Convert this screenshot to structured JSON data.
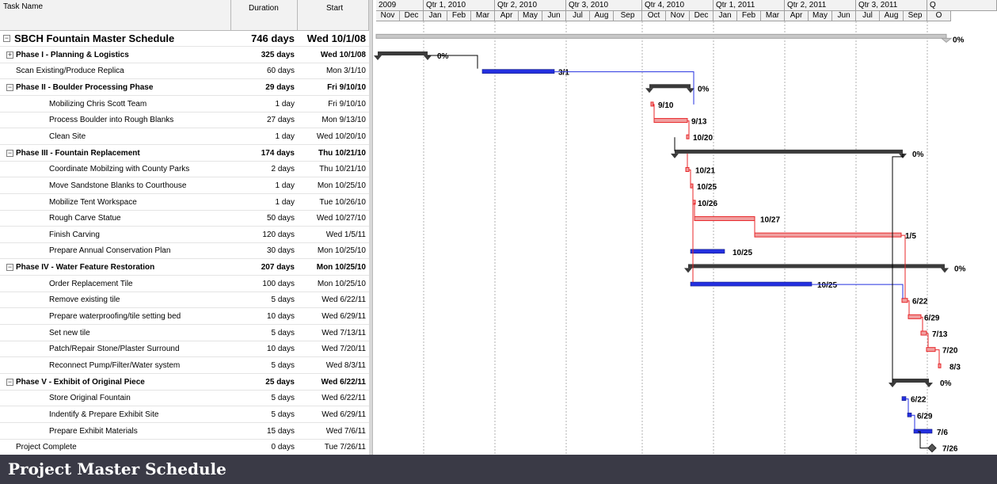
{
  "columns": {
    "name": "Task Name",
    "duration": "Duration",
    "start": "Start"
  },
  "timeline_top": [
    "2009",
    "Qtr 1, 2010",
    "Qtr 2, 2010",
    "Qtr 3, 2010",
    "Qtr 4, 2010",
    "Qtr 1, 2011",
    "Qtr 2, 2011",
    "Qtr 3, 2011",
    "Q"
  ],
  "timeline_months": [
    "Nov",
    "Dec",
    "Jan",
    "Feb",
    "Mar",
    "Apr",
    "May",
    "Jun",
    "Jul",
    "Aug",
    "Sep",
    "Oct",
    "Nov",
    "Dec",
    "Jan",
    "Feb",
    "Mar",
    "Apr",
    "May",
    "Jun",
    "Jul",
    "Aug",
    "Sep",
    "O"
  ],
  "colors": {
    "critical": "#e8272a",
    "normal": "#2430e0",
    "summary": "#3a3a3a",
    "footer": "#3a3a46"
  },
  "tasks": [
    {
      "name": "SBCH Fountain Master Schedule",
      "duration": "746 days",
      "start": "Wed 10/1/08",
      "level": 0,
      "type": "top",
      "collapsible": "minus",
      "label": "0%"
    },
    {
      "name": "Phase I - Planning & Logistics",
      "duration": "325 days",
      "start": "Wed 10/1/08",
      "level": 1,
      "type": "summary",
      "collapsible": "plus",
      "label": "0%"
    },
    {
      "name": "Scan Existing/Produce Replica",
      "duration": "60 days",
      "start": "Mon 3/1/10",
      "level": 1,
      "type": "normal",
      "collapsible": "",
      "label": "3/1"
    },
    {
      "name": "Phase II - Boulder Processing Phase",
      "duration": "29 days",
      "start": "Fri 9/10/10",
      "level": 1,
      "type": "summary",
      "collapsible": "minus",
      "label": "0%"
    },
    {
      "name": "Mobilizing Chris Scott Team",
      "duration": "1 day",
      "start": "Fri 9/10/10",
      "level": 2,
      "type": "critical",
      "collapsible": "",
      "label": "9/10"
    },
    {
      "name": "Process Boulder into Rough Blanks",
      "duration": "27 days",
      "start": "Mon 9/13/10",
      "level": 2,
      "type": "critical",
      "collapsible": "",
      "label": "9/13"
    },
    {
      "name": "Clean Site",
      "duration": "1 day",
      "start": "Wed 10/20/10",
      "level": 2,
      "type": "critical",
      "collapsible": "",
      "label": "10/20"
    },
    {
      "name": "Phase III - Fountain Replacement",
      "duration": "174 days",
      "start": "Thu 10/21/10",
      "level": 1,
      "type": "summary",
      "collapsible": "minus",
      "label": "0%"
    },
    {
      "name": "Coordinate Mobilzing with County Parks",
      "duration": "2 days",
      "start": "Thu 10/21/10",
      "level": 2,
      "type": "critical",
      "collapsible": "",
      "label": "10/21"
    },
    {
      "name": "Move Sandstone Blanks to Courthouse",
      "duration": "1 day",
      "start": "Mon 10/25/10",
      "level": 2,
      "type": "critical",
      "collapsible": "",
      "label": "10/25"
    },
    {
      "name": "Mobilize Tent Workspace",
      "duration": "1 day",
      "start": "Tue 10/26/10",
      "level": 2,
      "type": "critical",
      "collapsible": "",
      "label": "10/26"
    },
    {
      "name": "Rough Carve Statue",
      "duration": "50 days",
      "start": "Wed 10/27/10",
      "level": 2,
      "type": "critical",
      "collapsible": "",
      "label": "10/27"
    },
    {
      "name": "Finish Carving",
      "duration": "120 days",
      "start": "Wed 1/5/11",
      "level": 2,
      "type": "critical",
      "collapsible": "",
      "label": "1/5"
    },
    {
      "name": "Prepare Annual Conservation Plan",
      "duration": "30 days",
      "start": "Mon 10/25/10",
      "level": 2,
      "type": "normal",
      "collapsible": "",
      "label": "10/25"
    },
    {
      "name": "Phase IV - Water Feature Restoration",
      "duration": "207 days",
      "start": "Mon 10/25/10",
      "level": 1,
      "type": "summary",
      "collapsible": "minus",
      "label": "0%"
    },
    {
      "name": "Order Replacement Tile",
      "duration": "100 days",
      "start": "Mon 10/25/10",
      "level": 2,
      "type": "normal",
      "collapsible": "",
      "label": "10/25"
    },
    {
      "name": "Remove existing tile",
      "duration": "5 days",
      "start": "Wed 6/22/11",
      "level": 2,
      "type": "critical",
      "collapsible": "",
      "label": "6/22"
    },
    {
      "name": "Prepare waterproofing/tile setting bed",
      "duration": "10 days",
      "start": "Wed 6/29/11",
      "level": 2,
      "type": "critical",
      "collapsible": "",
      "label": "6/29"
    },
    {
      "name": "Set new tile",
      "duration": "5 days",
      "start": "Wed 7/13/11",
      "level": 2,
      "type": "critical",
      "collapsible": "",
      "label": "7/13"
    },
    {
      "name": "Patch/Repair Stone/Plaster Surround",
      "duration": "10 days",
      "start": "Wed 7/20/11",
      "level": 2,
      "type": "critical",
      "collapsible": "",
      "label": "7/20"
    },
    {
      "name": "Reconnect Pump/Filter/Water system",
      "duration": "5 days",
      "start": "Wed 8/3/11",
      "level": 2,
      "type": "critical",
      "collapsible": "",
      "label": "8/3"
    },
    {
      "name": "Phase V - Exhibit of Original Piece",
      "duration": "25 days",
      "start": "Wed 6/22/11",
      "level": 1,
      "type": "summary",
      "collapsible": "minus",
      "label": "0%"
    },
    {
      "name": "Store Original Fountain",
      "duration": "5 days",
      "start": "Wed 6/22/11",
      "level": 2,
      "type": "normal",
      "collapsible": "",
      "label": "6/22"
    },
    {
      "name": "Indentify & Prepare Exhibit Site",
      "duration": "5 days",
      "start": "Wed 6/29/11",
      "level": 2,
      "type": "normal",
      "collapsible": "",
      "label": "6/29"
    },
    {
      "name": "Prepare Exhibit Materials",
      "duration": "15 days",
      "start": "Wed 7/6/11",
      "level": 2,
      "type": "normal",
      "collapsible": "",
      "label": "7/6"
    },
    {
      "name": "Project Complete",
      "duration": "0 days",
      "start": "Tue 7/26/11",
      "level": 1,
      "type": "milestone",
      "collapsible": "",
      "label": "7/26"
    }
  ],
  "footer": {
    "title": "Project Master Schedule"
  }
}
